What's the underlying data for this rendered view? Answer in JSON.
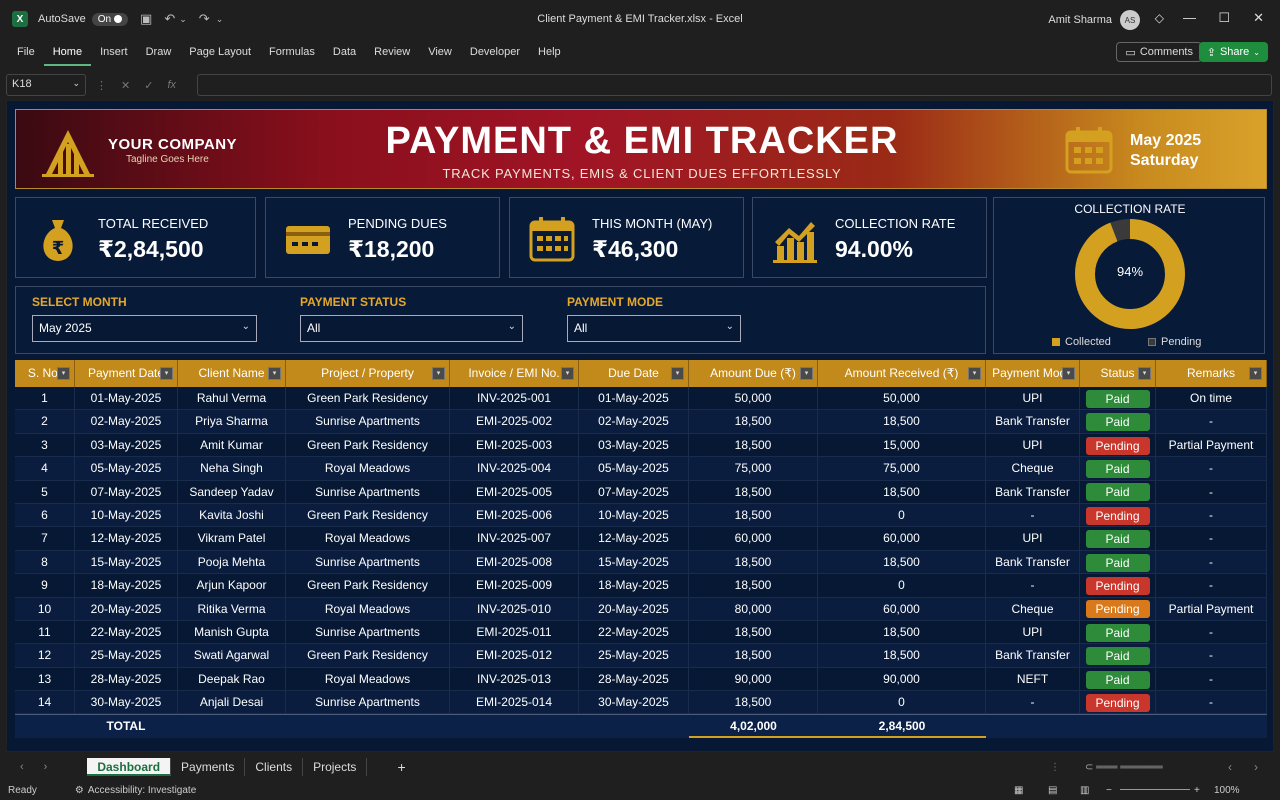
{
  "titlebar": {
    "logo": "X",
    "autosave_label": "AutoSave",
    "autosave_state": "On",
    "doc_title": "Client Payment & EMI Tracker.xlsx  -  Excel",
    "user_name": "Amit Sharma",
    "user_initials": "AS"
  },
  "menu": {
    "items": [
      "File",
      "Home",
      "Insert",
      "Draw",
      "Page Layout",
      "Formulas",
      "Data",
      "Review",
      "View",
      "Developer",
      "Help"
    ],
    "active": "Home",
    "comments": "Comments",
    "share": "Share"
  },
  "formula_bar": {
    "cell_ref": "K18",
    "fx": "fx"
  },
  "banner": {
    "company": "YOUR COMPANY",
    "tagline": "Tagline Goes Here",
    "title": "PAYMENT & EMI TRACKER",
    "subtitle": "TRACK PAYMENTS, EMIS & CLIENT DUES EFFORTLESSLY",
    "month": "May 2025",
    "day": "Saturday"
  },
  "kpis": [
    {
      "label": "TOTAL RECEIVED",
      "value": "₹2,84,500",
      "icon": "money-bag-icon"
    },
    {
      "label": "PENDING DUES",
      "value": "₹18,200",
      "icon": "card-icon"
    },
    {
      "label": "THIS MONTH (MAY)",
      "value": "₹46,300",
      "icon": "calendar-icon"
    },
    {
      "label": "COLLECTION RATE",
      "value": "94.00%",
      "icon": "growth-chart-icon"
    }
  ],
  "collection_chart": {
    "title": "COLLECTION RATE",
    "center_label": "94%",
    "collected_fraction": 0.94,
    "legend_collected": "Collected",
    "legend_pending": "Pending",
    "color_collected": "#d4a020",
    "color_pending": "#3a3a3a"
  },
  "filters": {
    "month_label": "SELECT MONTH",
    "month_value": "May 2025",
    "status_label": "PAYMENT STATUS",
    "status_value": "All",
    "mode_label": "PAYMENT MODE",
    "mode_value": "All"
  },
  "table": {
    "headers": [
      "S. No.",
      "Payment Date",
      "Client Name",
      "Project / Property",
      "Invoice / EMI No.",
      "Due Date",
      "Amount Due (₹)",
      "Amount Received (₹)",
      "Payment Mode",
      "Status",
      "Remarks"
    ],
    "rows": [
      [
        "1",
        "01-May-2025",
        "Rahul Verma",
        "Green Park Residency",
        "INV-2025-001",
        "01-May-2025",
        "50,000",
        "50,000",
        "UPI",
        "Paid",
        "On time"
      ],
      [
        "2",
        "02-May-2025",
        "Priya Sharma",
        "Sunrise Apartments",
        "EMI-2025-002",
        "02-May-2025",
        "18,500",
        "18,500",
        "Bank Transfer",
        "Paid",
        "-"
      ],
      [
        "3",
        "03-May-2025",
        "Amit Kumar",
        "Green Park Residency",
        "EMI-2025-003",
        "03-May-2025",
        "18,500",
        "15,000",
        "UPI",
        "Pending",
        "Partial Payment"
      ],
      [
        "4",
        "05-May-2025",
        "Neha Singh",
        "Royal Meadows",
        "INV-2025-004",
        "05-May-2025",
        "75,000",
        "75,000",
        "Cheque",
        "Paid",
        "-"
      ],
      [
        "5",
        "07-May-2025",
        "Sandeep Yadav",
        "Sunrise Apartments",
        "EMI-2025-005",
        "07-May-2025",
        "18,500",
        "18,500",
        "Bank Transfer",
        "Paid",
        "-"
      ],
      [
        "6",
        "10-May-2025",
        "Kavita Joshi",
        "Green Park Residency",
        "EMI-2025-006",
        "10-May-2025",
        "18,500",
        "0",
        "-",
        "Pending",
        "-"
      ],
      [
        "7",
        "12-May-2025",
        "Vikram Patel",
        "Royal Meadows",
        "INV-2025-007",
        "12-May-2025",
        "60,000",
        "60,000",
        "UPI",
        "Paid",
        "-"
      ],
      [
        "8",
        "15-May-2025",
        "Pooja Mehta",
        "Sunrise Apartments",
        "EMI-2025-008",
        "15-May-2025",
        "18,500",
        "18,500",
        "Bank Transfer",
        "Paid",
        "-"
      ],
      [
        "9",
        "18-May-2025",
        "Arjun Kapoor",
        "Green Park Residency",
        "EMI-2025-009",
        "18-May-2025",
        "18,500",
        "0",
        "-",
        "Pending",
        "-"
      ],
      [
        "10",
        "20-May-2025",
        "Ritika Verma",
        "Royal Meadows",
        "INV-2025-010",
        "20-May-2025",
        "80,000",
        "60,000",
        "Cheque",
        "Pending",
        "Partial Payment"
      ],
      [
        "11",
        "22-May-2025",
        "Manish Gupta",
        "Sunrise Apartments",
        "EMI-2025-011",
        "22-May-2025",
        "18,500",
        "18,500",
        "UPI",
        "Paid",
        "-"
      ],
      [
        "12",
        "25-May-2025",
        "Swati Agarwal",
        "Green Park Residency",
        "EMI-2025-012",
        "25-May-2025",
        "18,500",
        "18,500",
        "Bank Transfer",
        "Paid",
        "-"
      ],
      [
        "13",
        "28-May-2025",
        "Deepak Rao",
        "Royal Meadows",
        "INV-2025-013",
        "28-May-2025",
        "90,000",
        "90,000",
        "NEFT",
        "Paid",
        "-"
      ],
      [
        "14",
        "30-May-2025",
        "Anjali Desai",
        "Sunrise Apartments",
        "EMI-2025-014",
        "30-May-2025",
        "18,500",
        "0",
        "-",
        "Pending",
        "-"
      ]
    ],
    "total_label": "TOTAL",
    "total_due": "4,02,000",
    "total_received": "2,84,500"
  },
  "sheet_tabs": [
    "Dashboard",
    "Payments",
    "Clients",
    "Projects"
  ],
  "status_bar": {
    "ready": "Ready",
    "accessibility": "Accessibility: Investigate",
    "zoom": "100%"
  }
}
